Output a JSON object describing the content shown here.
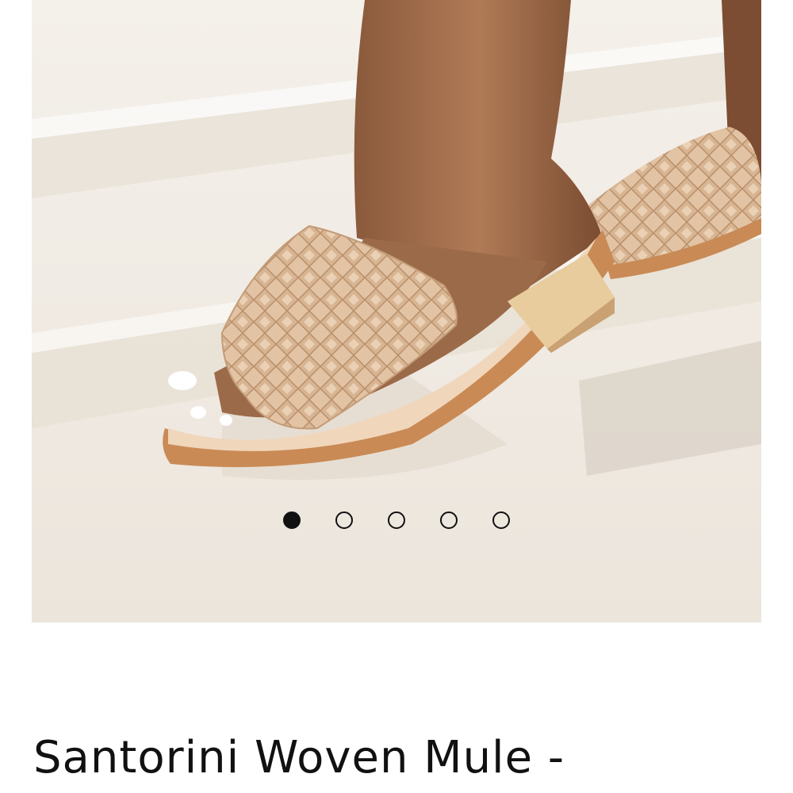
{
  "product": {
    "title": "Santorini Woven Mule -",
    "image_alt": "Woven leather mule sandal on stone steps"
  },
  "carousel": {
    "total": 5,
    "active_index": 0
  },
  "colors": {
    "background": "#ffffff",
    "text": "#111111",
    "dot": "#111111",
    "sandal_weave": "#e2c3a4",
    "sandal_sole": "#c98a55",
    "heel_wood": "#e8cc9e",
    "stone": "#efe9e1"
  }
}
